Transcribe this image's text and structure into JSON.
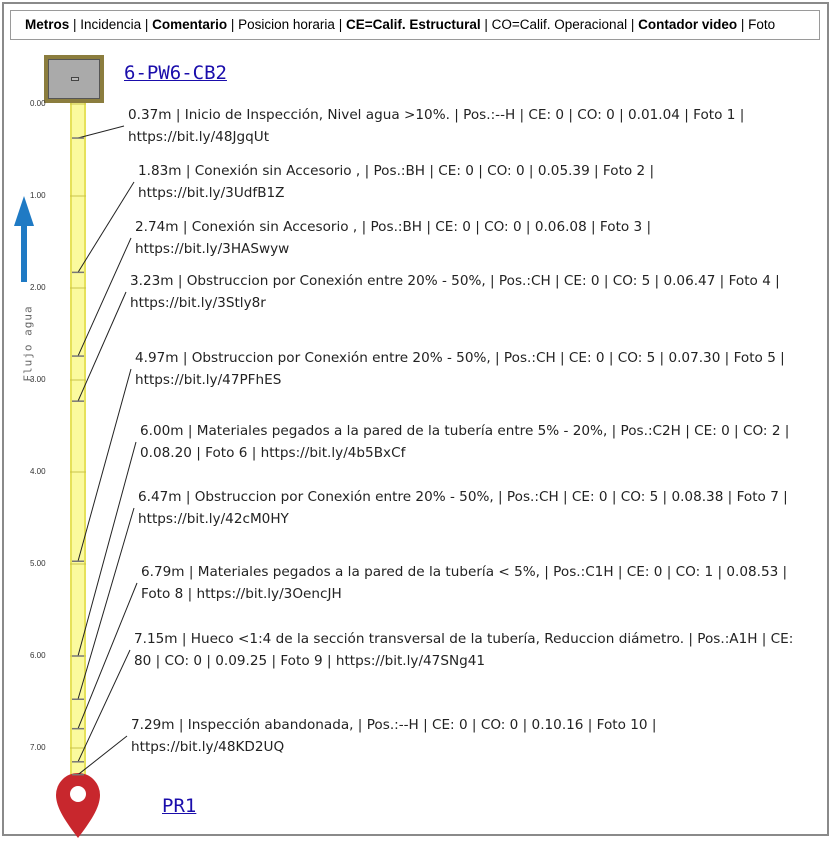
{
  "legend": {
    "metros": "Metros",
    "incidencia": "Incidencia",
    "comentario": "Comentario",
    "posicion": "Posicion horaria",
    "ce": "CE=Calif. Estructural",
    "co": "CO=Calif. Operacional",
    "contador": "Contador video",
    "foto": "Foto",
    "sep": " | "
  },
  "start_node": "6-PW6-CB2",
  "end_node": "PR1",
  "flow_label": "Flujo agua",
  "scale": {
    "ticks": [
      "0.00",
      "1.00",
      "2.00",
      "3.00",
      "4.00",
      "5.00",
      "6.00",
      "7.00"
    ],
    "min": 0,
    "max": 7.29
  },
  "colors": {
    "pipe_fill": "#fbfa9e",
    "pipe_edge": "#e6e15a",
    "flow_arrow": "#1f7ac4",
    "marker": "#c8272d",
    "link": "#1a0dab"
  },
  "defects": [
    {
      "position_m": 0.37,
      "text": "0.37m | Inicio de Inspección, Nivel agua >10%. | Pos.:--H | CE: 0 | CO: 0 | 0.01.04 | Foto 1 | https://bit.ly/48JgqUt"
    },
    {
      "position_m": 1.83,
      "text": "1.83m | Conexión sin Accesorio , | Pos.:BH | CE: 0 | CO: 0 | 0.05.39 | Foto 2 | https://bit.ly/3UdfB1Z"
    },
    {
      "position_m": 2.74,
      "text": "2.74m | Conexión sin Accesorio , | Pos.:BH | CE: 0 | CO: 0 | 0.06.08 | Foto 3 | https://bit.ly/3HASwyw"
    },
    {
      "position_m": 3.23,
      "text": "3.23m | Obstruccion por Conexión entre 20% - 50%, | Pos.:CH | CE: 0 | CO: 5 | 0.06.47 | Foto 4 | https://bit.ly/3Stly8r"
    },
    {
      "position_m": 4.97,
      "text": "4.97m | Obstruccion por Conexión entre 20% - 50%, | Pos.:CH | CE: 0 | CO: 5 | 0.07.30 | Foto 5 | https://bit.ly/47PFhES"
    },
    {
      "position_m": 6.0,
      "text": "6.00m | Materiales pegados a la pared de la tubería entre 5% - 20%, | Pos.:C2H | CE: 0 | CO: 2 | 0.08.20 | Foto 6 | https://bit.ly/4b5BxCf"
    },
    {
      "position_m": 6.47,
      "text": "6.47m | Obstruccion por Conexión entre 20% - 50%, | Pos.:CH | CE: 0 | CO: 5 | 0.08.38 | Foto 7 | https://bit.ly/42cM0HY"
    },
    {
      "position_m": 6.79,
      "text": "6.79m | Materiales pegados a la pared de la tubería < 5%, | Pos.:C1H | CE: 0 | CO: 1 | 0.08.53 | Foto 8 | https://bit.ly/3OencJH"
    },
    {
      "position_m": 7.15,
      "text": "7.15m | Hueco <1:4 de la sección transversal de la tubería, Reduccion diámetro. | Pos.:A1H | CE: 80 | CO: 0 | 0.09.25 | Foto 9 | https://bit.ly/47SNg41"
    },
    {
      "position_m": 7.29,
      "text": "7.29m | Inspección abandonada, | Pos.:--H | CE: 0 | CO: 0 | 0.10.16 | Foto 10 | https://bit.ly/48KD2UQ"
    }
  ]
}
